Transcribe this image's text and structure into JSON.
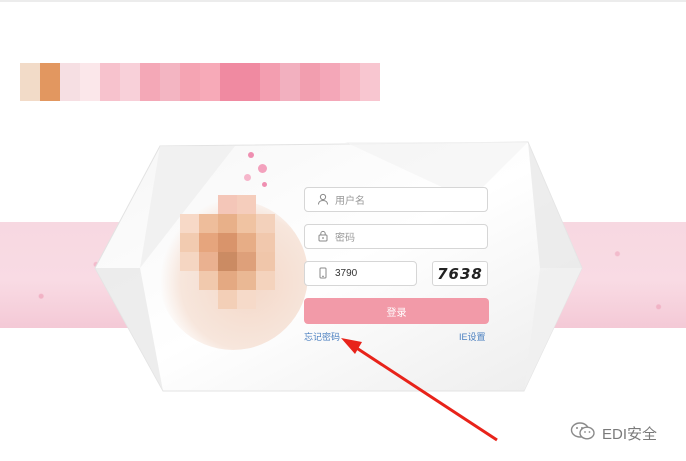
{
  "logo": {
    "colors": [
      "#f2dbc8",
      "#e29760",
      "#f6dfe3",
      "#fbe7ea",
      "#f7c2cd",
      "#f8d0d9",
      "#f4a8b7",
      "#f3b5c2",
      "#f5a4b3",
      "#f7aab8",
      "#f08aa1",
      "#f08aa1",
      "#f39eb0",
      "#f2b0bf",
      "#f29eaf",
      "#f4a7b8",
      "#f6b7c3",
      "#f8c6d0"
    ]
  },
  "form": {
    "username_placeholder": "用户名",
    "password_placeholder": "密码",
    "captcha_value": "3790",
    "captcha_image_text": "7638",
    "login_label": "登录",
    "forgot_label": "忘记密码",
    "ie_settings_label": "IE设置"
  },
  "watermark": {
    "text": "EDI安全"
  },
  "colors": {
    "login_button": "#f29aa8",
    "link": "#4a7fc0",
    "band": "#f7d8e1",
    "arrow": "#e8231a"
  }
}
